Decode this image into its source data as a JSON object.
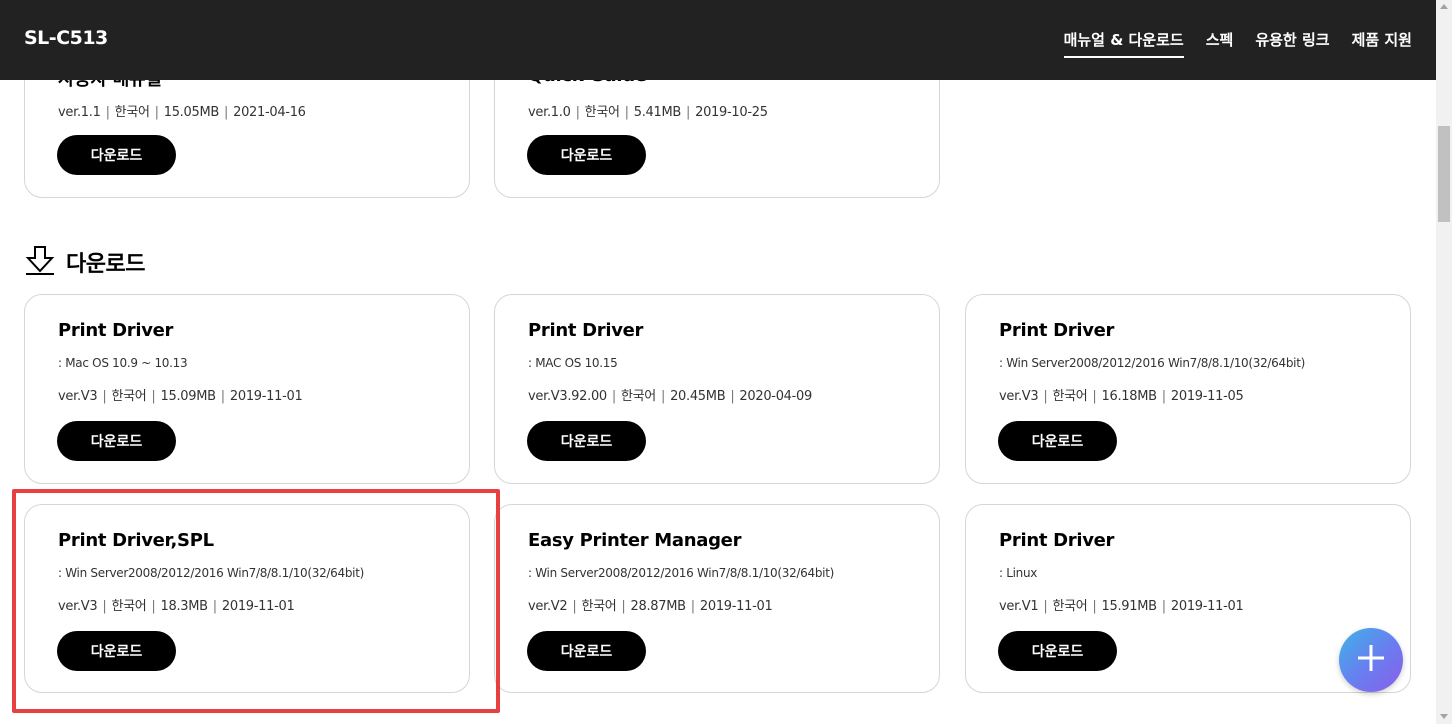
{
  "header": {
    "brand": "SL-C513",
    "nav": [
      "매뉴얼 & 다운로드",
      "스펙",
      "유용한 링크",
      "제품 지원"
    ]
  },
  "manuals": [
    {
      "title": "사용자 매뉴얼",
      "version": "ver.1.1",
      "language": "한국어",
      "size": "15.05MB",
      "date": "2021-04-16",
      "button": "다운로드"
    },
    {
      "title": "Quick Guide",
      "version": "ver.1.0",
      "language": "한국어",
      "size": "5.41MB",
      "date": "2019-10-25",
      "button": "다운로드"
    }
  ],
  "downloads_section": {
    "title": "다운로드"
  },
  "downloads": [
    {
      "title": "Print Driver",
      "os": ": Mac OS 10.9 ~ 10.13",
      "version": "ver.V3",
      "language": "한국어",
      "size": "15.09MB",
      "date": "2019-11-01",
      "button": "다운로드"
    },
    {
      "title": "Print Driver",
      "os": ": MAC OS 10.15",
      "version": "ver.V3.92.00",
      "language": "한국어",
      "size": "20.45MB",
      "date": "2020-04-09",
      "button": "다운로드"
    },
    {
      "title": "Print Driver",
      "os": ": Win Server2008/2012/2016 Win7/8/8.1/10(32/64bit)",
      "version": "ver.V3",
      "language": "한국어",
      "size": "16.18MB",
      "date": "2019-11-05",
      "button": "다운로드"
    },
    {
      "title": "Print Driver,SPL",
      "os": ": Win Server2008/2012/2016 Win7/8/8.1/10(32/64bit)",
      "version": "ver.V3",
      "language": "한국어",
      "size": "18.3MB",
      "date": "2019-11-01",
      "button": "다운로드"
    },
    {
      "title": "Easy Printer Manager",
      "os": ": Win Server2008/2012/2016 Win7/8/8.1/10(32/64bit)",
      "version": "ver.V2",
      "language": "한국어",
      "size": "28.87MB",
      "date": "2019-11-01",
      "button": "다운로드"
    },
    {
      "title": "Print Driver",
      "os": ": Linux",
      "version": "ver.V1",
      "language": "한국어",
      "size": "15.91MB",
      "date": "2019-11-01",
      "button": "다운로드"
    }
  ],
  "colors": {
    "header_bg": "#222222",
    "highlight": "#e84040",
    "button_bg": "#000000"
  },
  "icons": {
    "section": "download-arrow-icon",
    "fab": "plus-icon"
  }
}
